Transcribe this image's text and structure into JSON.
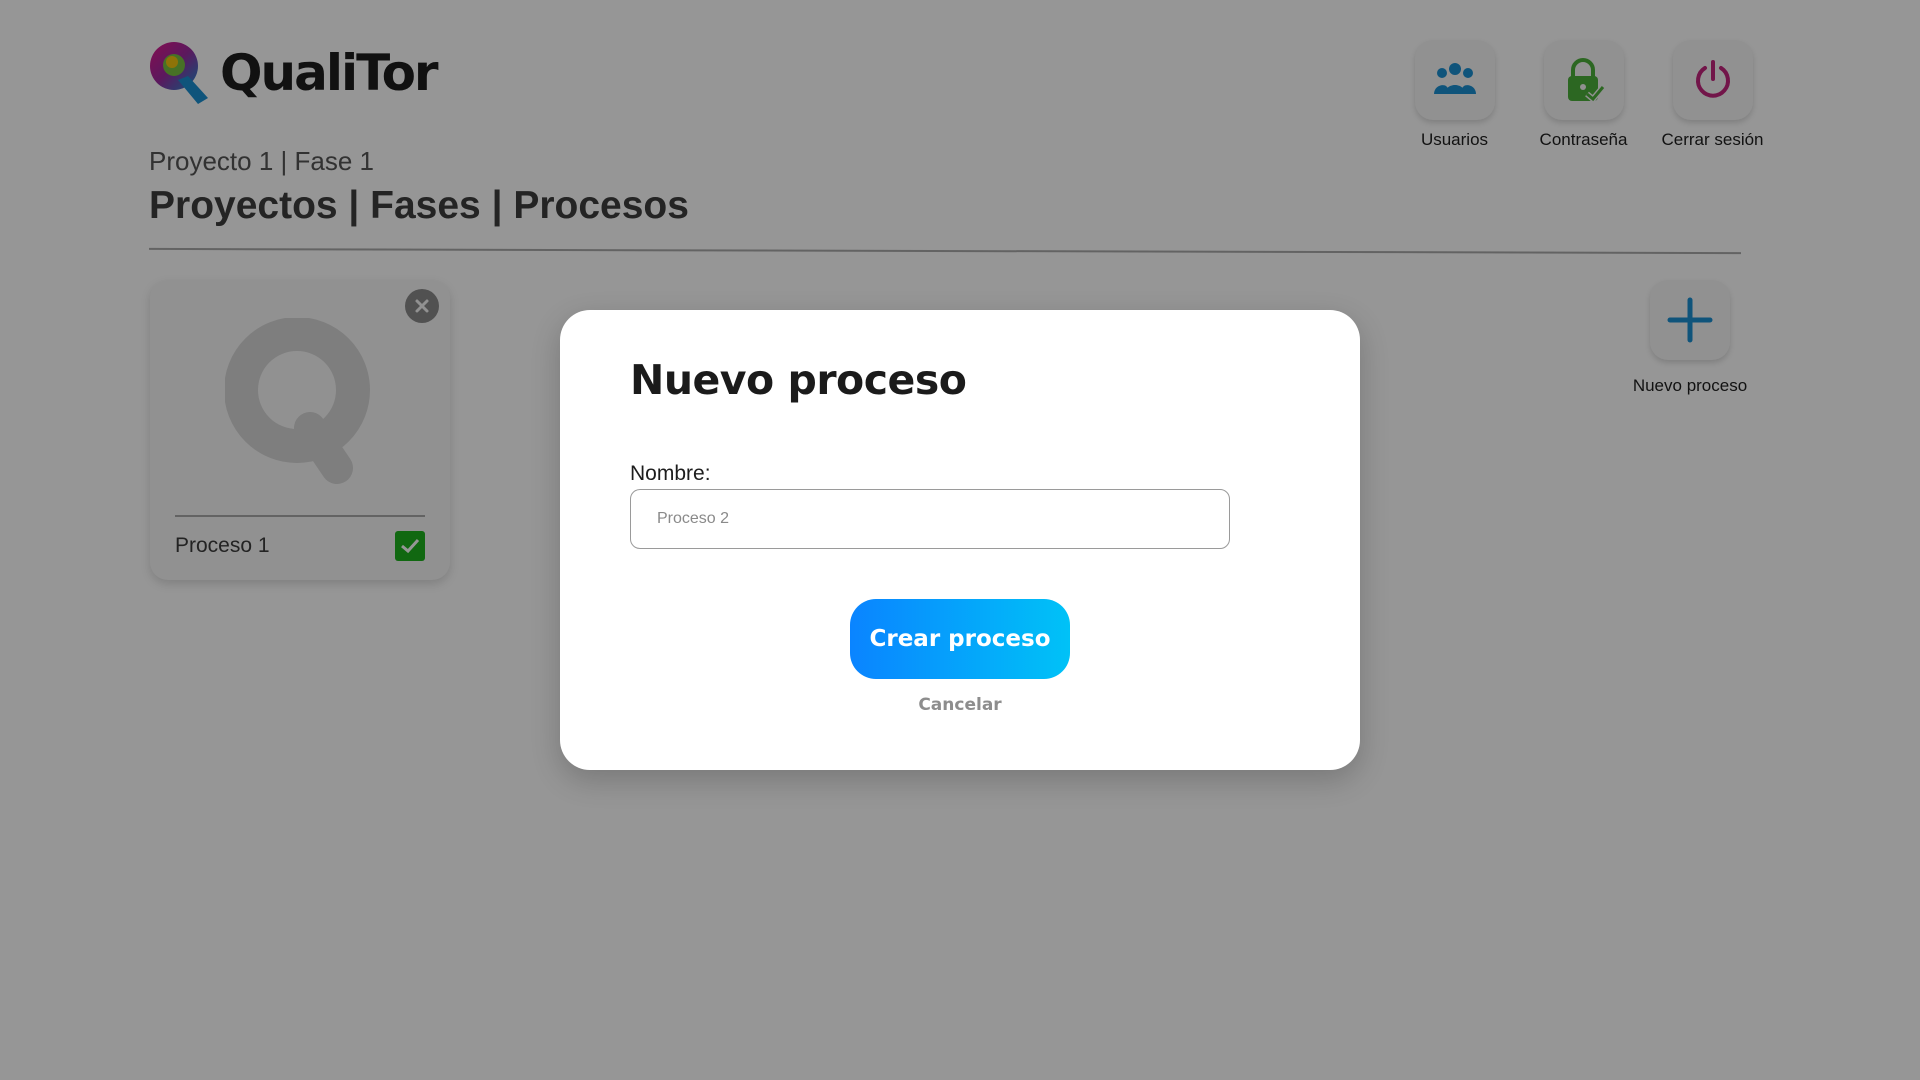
{
  "app": {
    "logo_text": "QualiTor",
    "breadcrumb": "Proyecto 1 | Fase 1",
    "heading": "Proyectos | Fases | Procesos"
  },
  "top_actions": [
    {
      "label": "Usuarios",
      "icon": "users-icon",
      "color": "#1a8fd1"
    },
    {
      "label": "Contraseña",
      "icon": "lock-check-icon",
      "color": "#4caf3a"
    },
    {
      "label": "Cerrar sesión",
      "icon": "power-icon",
      "color": "#c2247d"
    }
  ],
  "process_card": {
    "title": "Proceso 1",
    "status_icon": "check-icon",
    "status_color": "#1db21d"
  },
  "new_process": {
    "label": "Nuevo proceso",
    "icon": "plus-icon",
    "color": "#1a8fd1"
  },
  "modal": {
    "title": "Nuevo proceso",
    "field_label": "Nombre:",
    "field_placeholder": "Proceso 2",
    "field_value": "",
    "submit_label": "Crear proceso",
    "cancel_label": "Cancelar"
  },
  "colors": {
    "accent_gradient_start": "#0a84ff",
    "accent_gradient_end": "#00c2f7",
    "overlay": "rgba(0,0,0,0.41)"
  }
}
